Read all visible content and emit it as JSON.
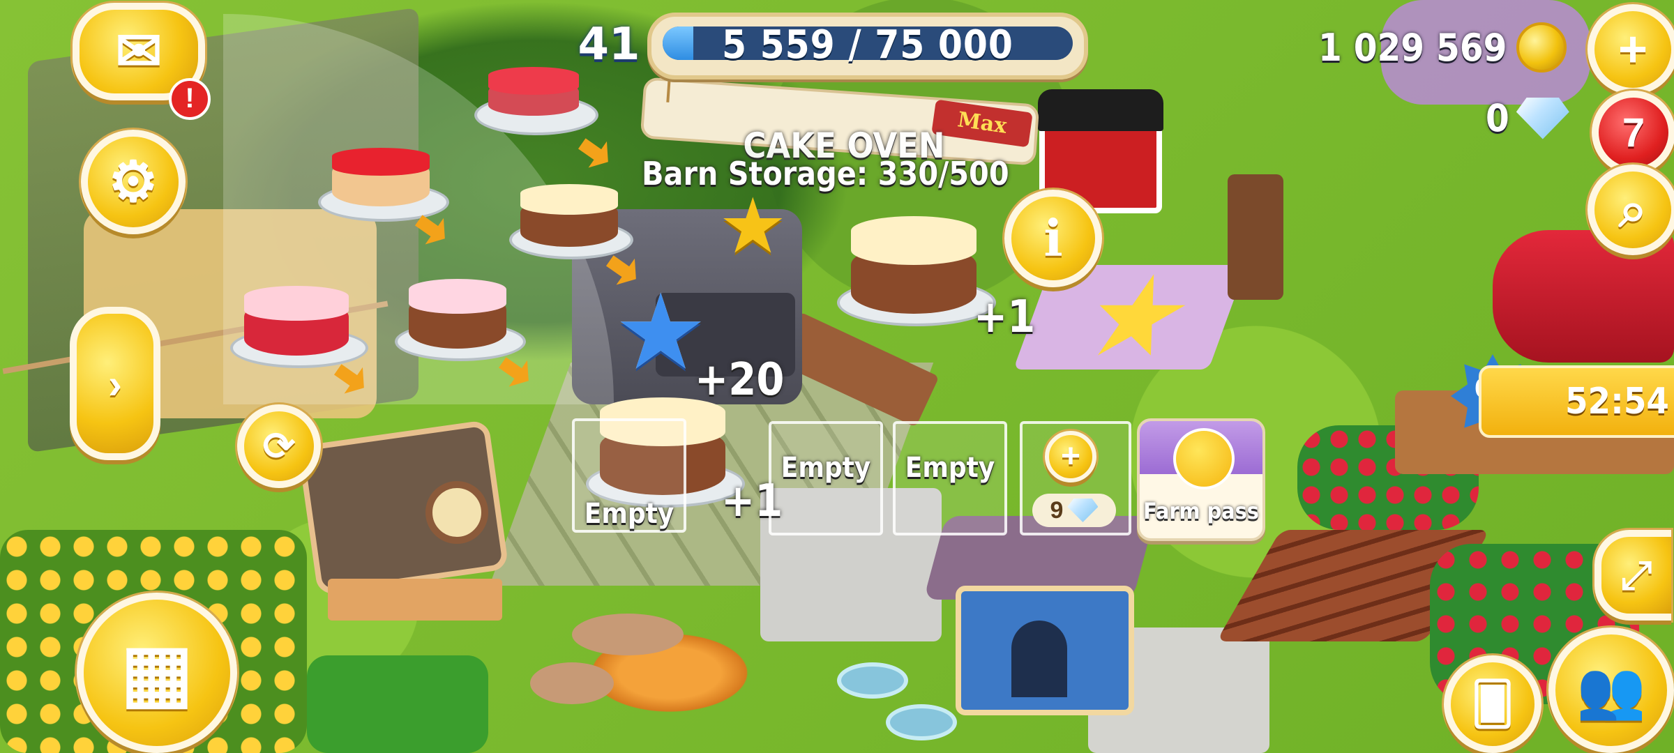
{
  "hud": {
    "level": "41",
    "xp_text": "5 559 / 75 000",
    "xp_fraction": 0.074,
    "coins": "1 029 569",
    "diamonds": "0",
    "notifications_count": "7",
    "mail_alert": "!"
  },
  "production": {
    "building_title": "CAKE OVEN",
    "barn_storage": "Barn Storage: 330/500",
    "max_tag": "Max",
    "xp_reward": "+20",
    "plus_one_a": "+1",
    "plus_one_b": "+1",
    "queue_slots": [
      {
        "label": "Empty"
      },
      {
        "label": "Empty"
      },
      {
        "label": "Empty"
      }
    ],
    "add_slot_cost": "9",
    "farm_pass_label": "Farm pass"
  },
  "recipes": [
    {
      "name": "cherry-cake"
    },
    {
      "name": "strawberry-cheesecake"
    },
    {
      "name": "carrot-cake"
    },
    {
      "name": "red-berry-cake"
    },
    {
      "name": "birthday-cake"
    }
  ],
  "offer": {
    "timer": "52:54"
  },
  "icons": {
    "mail": "mail-icon",
    "settings": "gear-icon",
    "sidebar": "chevron-right-icon",
    "refresh": "refresh-icon",
    "shop": "cash-register-icon",
    "add_coins": "plus-icon",
    "search": "magnifier-icon",
    "info": "info-icon",
    "friends": "friends-icon",
    "cards": "cards-icon",
    "expand": "expand-icon"
  },
  "colors": {
    "button_yellow": "#f6c413",
    "badge_red": "#e02020",
    "xp_blue": "#2f8de2"
  }
}
